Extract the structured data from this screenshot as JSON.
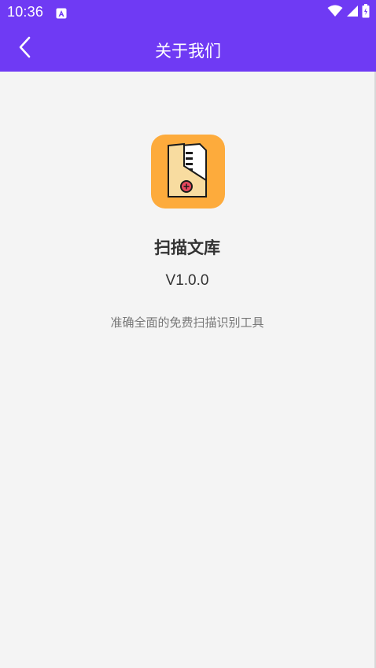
{
  "status_bar": {
    "time": "10:36",
    "icons": [
      "notification-a-icon",
      "wifi-icon",
      "cell-signal-icon",
      "battery-icon"
    ]
  },
  "app_bar": {
    "title": "关于我们",
    "back_icon": "chevron-left-icon"
  },
  "about": {
    "app_name": "扫描文库",
    "version": "V1.0.0",
    "description": "准确全面的免费扫描识别工具",
    "logo_icon": "scanned-document-icon"
  },
  "colors": {
    "primary": "#6f3af4",
    "background": "#f4f4f4",
    "logo_background": "#fdab3c",
    "title_text": "#333333",
    "description_text": "#777777"
  }
}
